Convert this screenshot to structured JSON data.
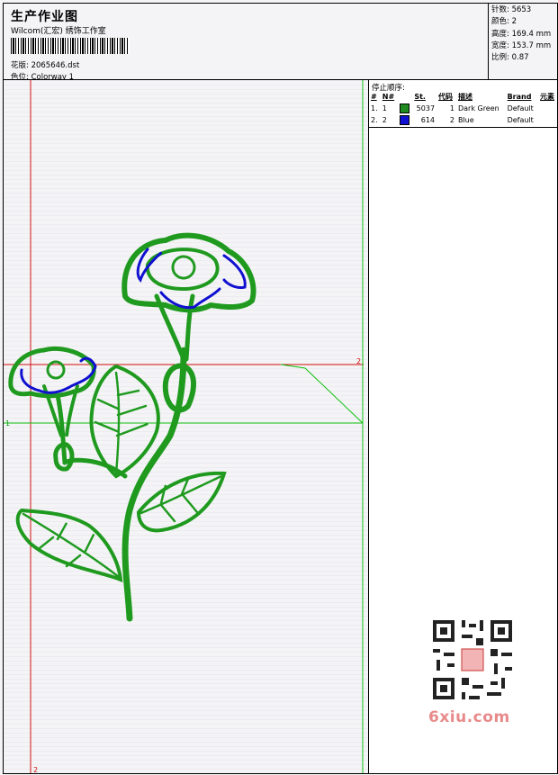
{
  "header": {
    "title": "生产作业图",
    "studio": "Wilcom(汇宏) 绣饰工作室",
    "design_file_label": "花版:",
    "design_file": "2065646.dst",
    "colorway_label": "色位:",
    "colorway": "Colorway 1"
  },
  "stats": {
    "stitches_label": "针数:",
    "stitches": "5653",
    "colors_label": "颜色:",
    "colors": "2",
    "height_label": "高度:",
    "height": "169.4 mm",
    "width_label": "宽度:",
    "width": "153.7 mm",
    "scale_label": "比例:",
    "scale": "0.87"
  },
  "stop_sequence": {
    "title": "停止顺序:",
    "headers": [
      "#",
      "N#",
      "St.",
      "代码",
      "描述",
      "Brand",
      "元素"
    ],
    "rows": [
      {
        "index": "1.",
        "n": "1",
        "color": "#1f8a1f",
        "stitches": "5037",
        "code": "1",
        "description": "Dark Green",
        "brand": "Default"
      },
      {
        "index": "2.",
        "n": "2",
        "color": "#1010d0",
        "stitches": "614",
        "code": "2",
        "description": "Blue",
        "brand": "Default"
      }
    ]
  },
  "guides": {
    "marker_1": "1",
    "marker_2_top": "2",
    "marker_2_bottom": "2"
  },
  "colors": {
    "red_guide": "#d01010",
    "green_guide": "#10c010",
    "thread_green": "#1f9a1f",
    "thread_blue": "#1010d0",
    "watermark": "#e88a8a"
  },
  "watermark": {
    "text": "6xiu.com"
  }
}
